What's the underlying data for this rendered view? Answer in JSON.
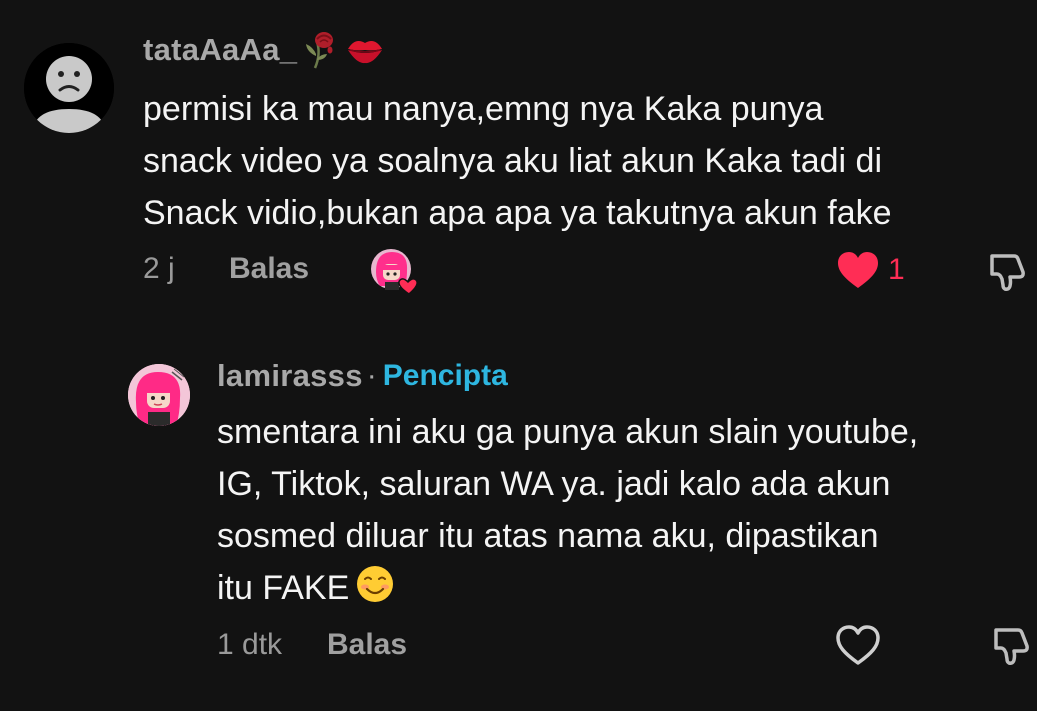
{
  "comments": [
    {
      "username": "tataAaAa_",
      "decor_icons": [
        "wilted-rose-icon",
        "kiss-lips-icon"
      ],
      "text": "permisi ka mau nanya,emng nya Kaka punya\nsnack video ya soalnya aku liat akun Kaka tadi di\nSnack vidio,bukan apa apa ya takutnya akun fake",
      "time": "2 j",
      "reply_label": "Balas",
      "creator_liked": true,
      "liked": true,
      "like_count": "1"
    },
    {
      "username": "lamirasss",
      "separator": "·",
      "creator_label": "Pencipta",
      "text": "smentara ini aku ga punya akun slain youtube,\nIG, Tiktok, saluran WA ya. jadi kalo ada akun\nsosmed diluar itu atas nama aku, dipastikan\nitu FAKE",
      "emoji": "smiling-face-icon",
      "time": "1 dtk",
      "reply_label": "Balas",
      "liked": false
    }
  ],
  "colors": {
    "background": "#121212",
    "like_active": "#ff2d55",
    "creator_label": "#2eb6e0"
  }
}
